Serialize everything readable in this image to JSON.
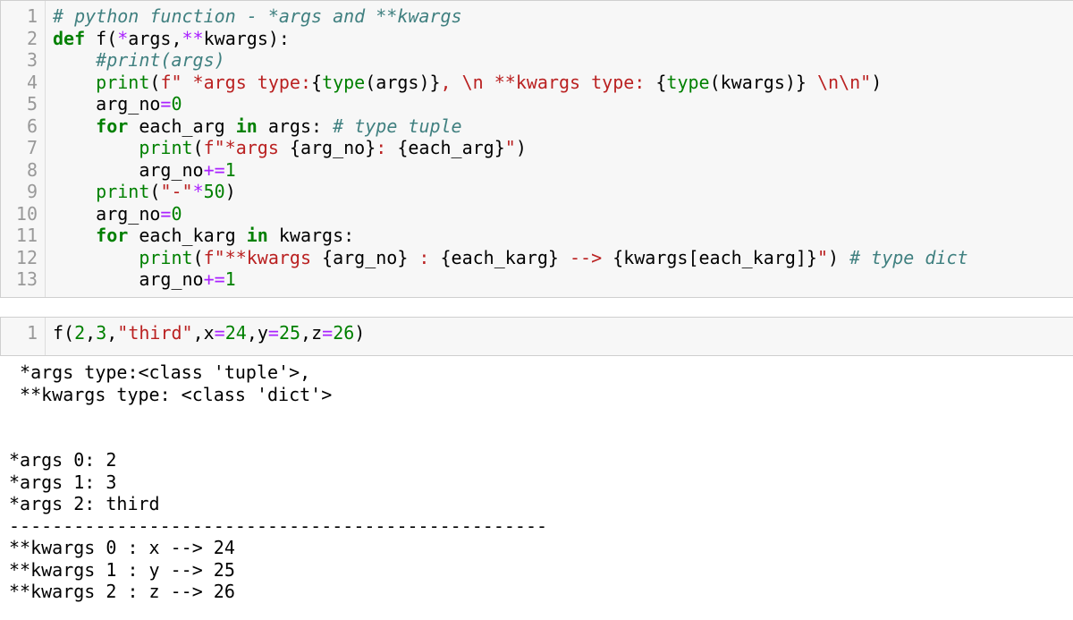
{
  "cells": [
    {
      "line_numbers": [
        "1",
        "2",
        "3",
        "4",
        "5",
        "6",
        "7",
        "8",
        "9",
        "10",
        "11",
        "12",
        "13"
      ],
      "lines": [
        [
          {
            "c": "com",
            "t": "# python function - *args and **kwargs"
          }
        ],
        [
          {
            "c": "kw",
            "t": "def"
          },
          {
            "c": "txt",
            "t": " f("
          },
          {
            "c": "op",
            "t": "*"
          },
          {
            "c": "txt",
            "t": "args,"
          },
          {
            "c": "op",
            "t": "**"
          },
          {
            "c": "txt",
            "t": "kwargs):"
          }
        ],
        [
          {
            "c": "txt",
            "t": "    "
          },
          {
            "c": "com",
            "t": "#print(args)"
          }
        ],
        [
          {
            "c": "txt",
            "t": "    "
          },
          {
            "c": "bi",
            "t": "print"
          },
          {
            "c": "txt",
            "t": "("
          },
          {
            "c": "str",
            "t": "f\" *args type:"
          },
          {
            "c": "txt",
            "t": "{"
          },
          {
            "c": "bi",
            "t": "type"
          },
          {
            "c": "txt",
            "t": "(args)}"
          },
          {
            "c": "str",
            "t": ", \\n **kwargs type: "
          },
          {
            "c": "txt",
            "t": "{"
          },
          {
            "c": "bi",
            "t": "type"
          },
          {
            "c": "txt",
            "t": "(kwargs)}"
          },
          {
            "c": "str",
            "t": " \\n\\n\""
          },
          {
            "c": "txt",
            "t": ")"
          }
        ],
        [
          {
            "c": "txt",
            "t": "    arg_no"
          },
          {
            "c": "op",
            "t": "="
          },
          {
            "c": "num",
            "t": "0"
          }
        ],
        [
          {
            "c": "txt",
            "t": "    "
          },
          {
            "c": "kw",
            "t": "for"
          },
          {
            "c": "txt",
            "t": " each_arg "
          },
          {
            "c": "kw",
            "t": "in"
          },
          {
            "c": "txt",
            "t": " args: "
          },
          {
            "c": "com",
            "t": "# type tuple"
          }
        ],
        [
          {
            "c": "txt",
            "t": "        "
          },
          {
            "c": "bi",
            "t": "print"
          },
          {
            "c": "txt",
            "t": "("
          },
          {
            "c": "str",
            "t": "f\"*args "
          },
          {
            "c": "txt",
            "t": "{arg_no}"
          },
          {
            "c": "str",
            "t": ": "
          },
          {
            "c": "txt",
            "t": "{each_arg}"
          },
          {
            "c": "str",
            "t": "\""
          },
          {
            "c": "txt",
            "t": ")"
          }
        ],
        [
          {
            "c": "txt",
            "t": "        arg_no"
          },
          {
            "c": "op",
            "t": "+="
          },
          {
            "c": "num",
            "t": "1"
          }
        ],
        [
          {
            "c": "txt",
            "t": "    "
          },
          {
            "c": "bi",
            "t": "print"
          },
          {
            "c": "txt",
            "t": "("
          },
          {
            "c": "str",
            "t": "\"-\""
          },
          {
            "c": "op",
            "t": "*"
          },
          {
            "c": "num",
            "t": "50"
          },
          {
            "c": "txt",
            "t": ")"
          }
        ],
        [
          {
            "c": "txt",
            "t": "    arg_no"
          },
          {
            "c": "op",
            "t": "="
          },
          {
            "c": "num",
            "t": "0"
          }
        ],
        [
          {
            "c": "txt",
            "t": "    "
          },
          {
            "c": "kw",
            "t": "for"
          },
          {
            "c": "txt",
            "t": " each_karg "
          },
          {
            "c": "kw",
            "t": "in"
          },
          {
            "c": "txt",
            "t": " kwargs:"
          }
        ],
        [
          {
            "c": "txt",
            "t": "        "
          },
          {
            "c": "bi",
            "t": "print"
          },
          {
            "c": "txt",
            "t": "("
          },
          {
            "c": "str",
            "t": "f\"**kwargs "
          },
          {
            "c": "txt",
            "t": "{arg_no}"
          },
          {
            "c": "str",
            "t": " : "
          },
          {
            "c": "txt",
            "t": "{each_karg}"
          },
          {
            "c": "str",
            "t": " --> "
          },
          {
            "c": "txt",
            "t": "{kwargs[each_karg]}"
          },
          {
            "c": "str",
            "t": "\""
          },
          {
            "c": "txt",
            "t": ") "
          },
          {
            "c": "com",
            "t": "# type dict"
          }
        ],
        [
          {
            "c": "txt",
            "t": "        arg_no"
          },
          {
            "c": "op",
            "t": "+="
          },
          {
            "c": "num",
            "t": "1"
          }
        ]
      ]
    },
    {
      "line_numbers": [
        "1"
      ],
      "lines": [
        [
          {
            "c": "txt",
            "t": "f("
          },
          {
            "c": "num",
            "t": "2"
          },
          {
            "c": "txt",
            "t": ","
          },
          {
            "c": "num",
            "t": "3"
          },
          {
            "c": "txt",
            "t": ","
          },
          {
            "c": "str",
            "t": "\"third\""
          },
          {
            "c": "txt",
            "t": ",x"
          },
          {
            "c": "op",
            "t": "="
          },
          {
            "c": "num",
            "t": "24"
          },
          {
            "c": "txt",
            "t": ",y"
          },
          {
            "c": "op",
            "t": "="
          },
          {
            "c": "num",
            "t": "25"
          },
          {
            "c": "txt",
            "t": ",z"
          },
          {
            "c": "op",
            "t": "="
          },
          {
            "c": "num",
            "t": "26"
          },
          {
            "c": "txt",
            "t": ")"
          }
        ]
      ]
    }
  ],
  "output": [
    " *args type:<class 'tuple'>,",
    " **kwargs type: <class 'dict'>",
    "",
    "",
    "*args 0: 2",
    "*args 1: 3",
    "*args 2: third",
    "--------------------------------------------------",
    "**kwargs 0 : x --> 24",
    "**kwargs 1 : y --> 25",
    "**kwargs 2 : z --> 26"
  ]
}
